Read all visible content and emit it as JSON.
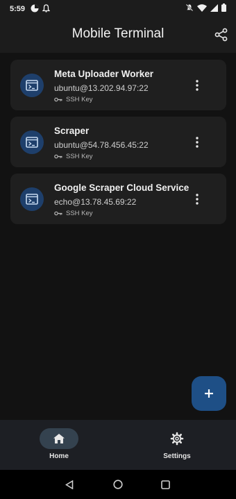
{
  "status_bar": {
    "time": "5:59",
    "left_icons": [
      "pinwheel-icon",
      "notification-bell-icon"
    ],
    "right_icons": [
      "do-not-disturb-icon",
      "wifi-icon",
      "signal-icon",
      "battery-icon"
    ]
  },
  "app_bar": {
    "title": "Mobile Terminal",
    "share_icon": "share-icon"
  },
  "connections": [
    {
      "title": "Meta Uploader Worker",
      "host": "ubuntu@13.202.94.97:22",
      "auth": "SSH Key"
    },
    {
      "title": "Scraper",
      "host": "ubuntu@54.78.456.45:22",
      "auth": "SSH Key"
    },
    {
      "title": "Google Scraper Cloud Service",
      "host": "echo@13.78.45.69:22",
      "auth": "SSH Key"
    }
  ],
  "fab": {
    "label": "+"
  },
  "bottom_nav": {
    "items": [
      {
        "label": "Home",
        "icon": "home-icon",
        "active": true
      },
      {
        "label": "Settings",
        "icon": "gear-icon",
        "active": false
      }
    ]
  },
  "colors": {
    "background": "#121212",
    "card": "#1f1f1f",
    "accent": "#1e4f86",
    "icon_circle": "#1e3f6b"
  }
}
